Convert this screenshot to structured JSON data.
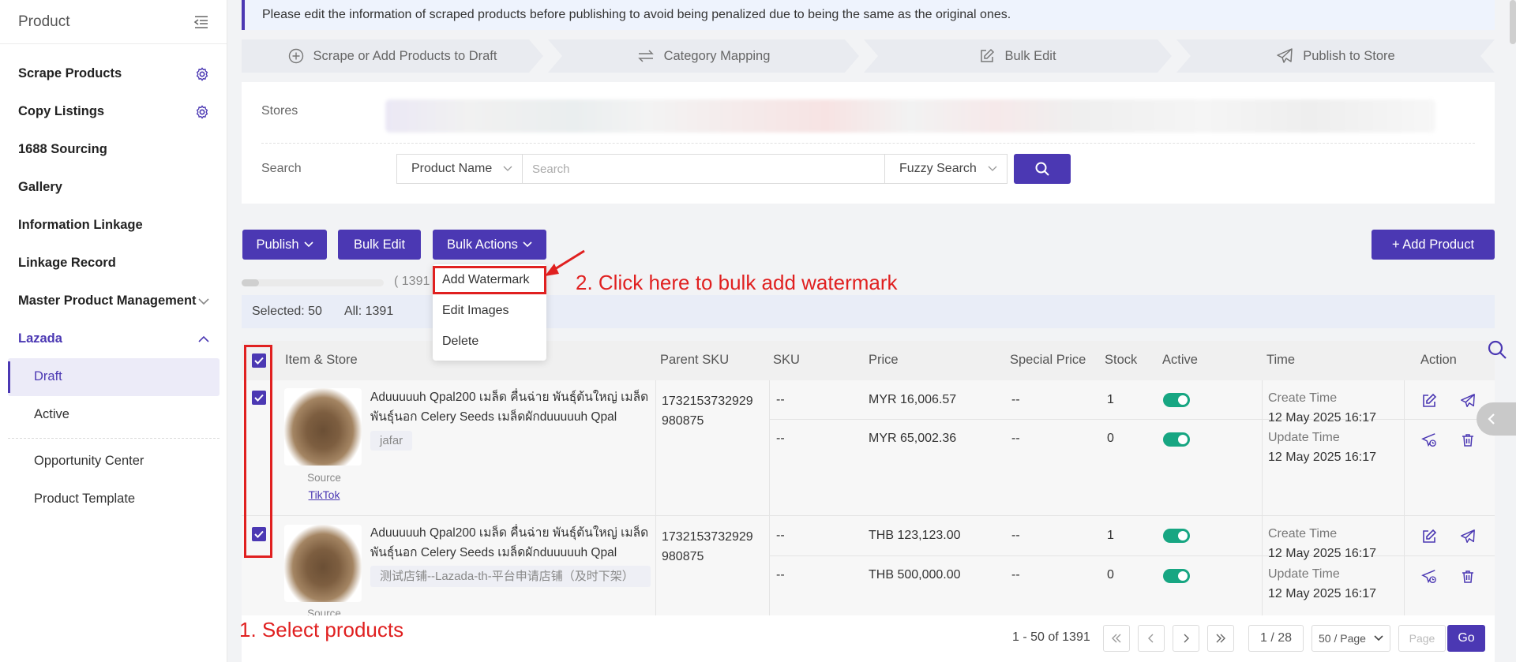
{
  "sidebar": {
    "title": "Product",
    "items": [
      {
        "label": "Scrape Products"
      },
      {
        "label": "Copy Listings"
      },
      {
        "label": "1688 Sourcing"
      },
      {
        "label": "Gallery"
      },
      {
        "label": "Information Linkage"
      },
      {
        "label": "Linkage Record"
      },
      {
        "label": "Master Product Management"
      },
      {
        "label": "Lazada"
      },
      {
        "label": "Draft"
      },
      {
        "label": "Active"
      },
      {
        "label": "Opportunity Center"
      },
      {
        "label": "Product Template"
      }
    ]
  },
  "notice": "Please edit the information of scraped products before publishing to avoid being penalized due to being the same as the original ones.",
  "steps": [
    {
      "label": "Scrape or Add Products to Draft",
      "icon": "plus-circle-icon"
    },
    {
      "label": "Category Mapping",
      "icon": "swap-arrows-icon"
    },
    {
      "label": "Bulk Edit",
      "icon": "edit-icon"
    },
    {
      "label": "Publish to Store",
      "icon": "send-icon"
    }
  ],
  "filter": {
    "stores_label": "Stores",
    "search_label": "Search",
    "field_select": "Product Name",
    "search_placeholder": "Search",
    "mode_select": "Fuzzy Search"
  },
  "toolbar": {
    "publish": "Publish",
    "bulk_edit": "Bulk Edit",
    "bulk_actions": "Bulk Actions",
    "add_product": "+ Add Product",
    "progress_count": "( 1391",
    "progress_fraction": 0.12
  },
  "bulk_menu": [
    "Add Watermark",
    "Edit Images",
    "Delete"
  ],
  "selection": {
    "selected": "Selected: 50",
    "all": "All: 1391"
  },
  "table": {
    "headers": [
      "Item & Store",
      "Parent SKU",
      "SKU",
      "Price",
      "Special Price",
      "Stock",
      "Active",
      "Time",
      "Action"
    ],
    "rows": [
      {
        "name": "Aduuuuuh Qpal200 เมล็ด คื่นฉ่าย พันธุ์ต้นใหญ่ เมล็ดพันธุ์นอก Celery Seeds เมล็ดผักduuuuuh Qpal",
        "store": "jafar",
        "source_label": "Source",
        "source": "TikTok",
        "parent_sku": "1732153732929 980875",
        "variants": [
          {
            "sku": "--",
            "price": "MYR 16,006.57",
            "special": "--",
            "stock": "1"
          },
          {
            "sku": "--",
            "price": "MYR 65,002.36",
            "special": "--",
            "stock": "0"
          }
        ],
        "create_label": "Create Time",
        "create_time": "12 May 2025 16:17",
        "update_label": "Update Time",
        "update_time": "12 May 2025 16:17"
      },
      {
        "name": "Aduuuuuh Qpal200 เมล็ด คื่นฉ่าย พันธุ์ต้นใหญ่ เมล็ดพันธุ์นอก Celery Seeds เมล็ดผักduuuuuh Qpal",
        "store": "测试店铺--Lazada-th-平台申请店铺（及时下架）",
        "source_label": "Source",
        "parent_sku": "1732153732929 980875",
        "variants": [
          {
            "sku": "--",
            "price": "THB 123,123.00",
            "special": "--",
            "stock": "1"
          },
          {
            "sku": "--",
            "price": "THB 500,000.00",
            "special": "--",
            "stock": "0"
          }
        ],
        "create_label": "Create Time",
        "create_time": "12 May 2025 16:17",
        "update_label": "Update Time",
        "update_time": "12 May 2025 16:17"
      }
    ]
  },
  "pagination": {
    "summary": "1 - 50 of 1391",
    "page": "1 / 28",
    "per_page": "50 / Page",
    "page_placeholder": "Page",
    "go": "Go"
  },
  "annotations": {
    "step1": "1. Select products",
    "step2": "2. Click here to bulk add watermark"
  },
  "colors": {
    "accent": "#4b38b3",
    "annotation": "#e02020",
    "toggle_on": "#17a682"
  }
}
